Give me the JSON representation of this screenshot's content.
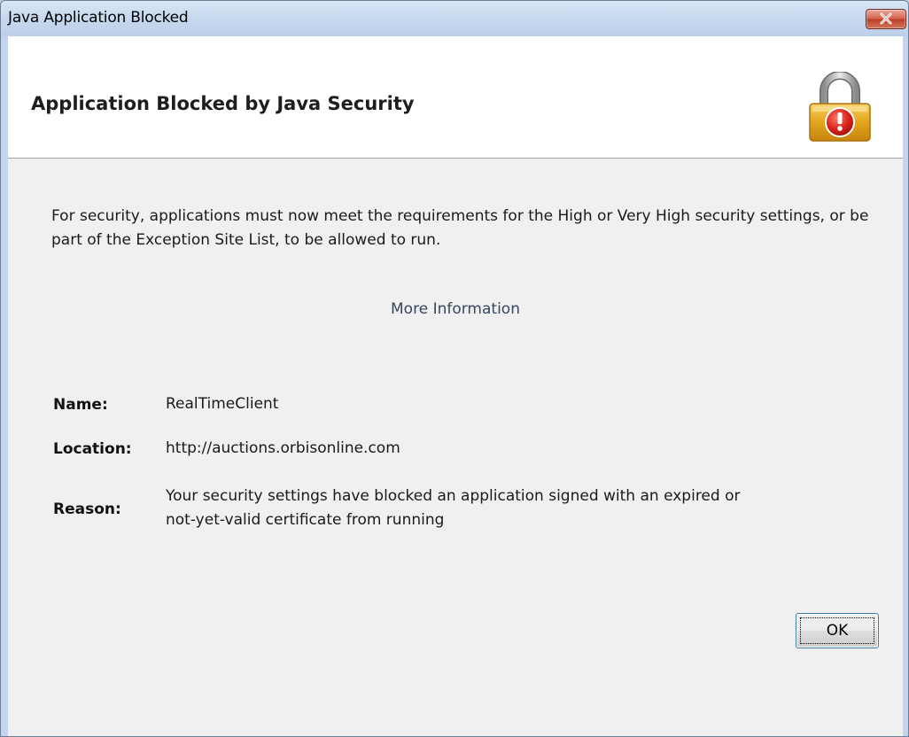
{
  "window": {
    "title": "Java Application Blocked"
  },
  "header": {
    "title": "Application Blocked by Java Security",
    "icon": "padlock-warning-icon"
  },
  "content": {
    "message": "For security, applications must now meet the requirements for the High or Very High security settings, or be part of the Exception Site List, to be allowed to run.",
    "more_info_link": "More Information",
    "fields": {
      "name_label": "Name:",
      "name_value": "RealTimeClient",
      "location_label": "Location:",
      "location_value": "http://auctions.orbisonline.com",
      "reason_label": "Reason:",
      "reason_value_line1": "Your security settings have blocked an application signed with an expired or",
      "reason_value_line2": "not-yet-valid certificate from running"
    }
  },
  "buttons": {
    "ok_label": "OK"
  },
  "colors": {
    "title_bar": "#c5d7ee",
    "close_button": "#c7472f",
    "link": "#37475f",
    "body_bg": "#f0f0f0"
  }
}
